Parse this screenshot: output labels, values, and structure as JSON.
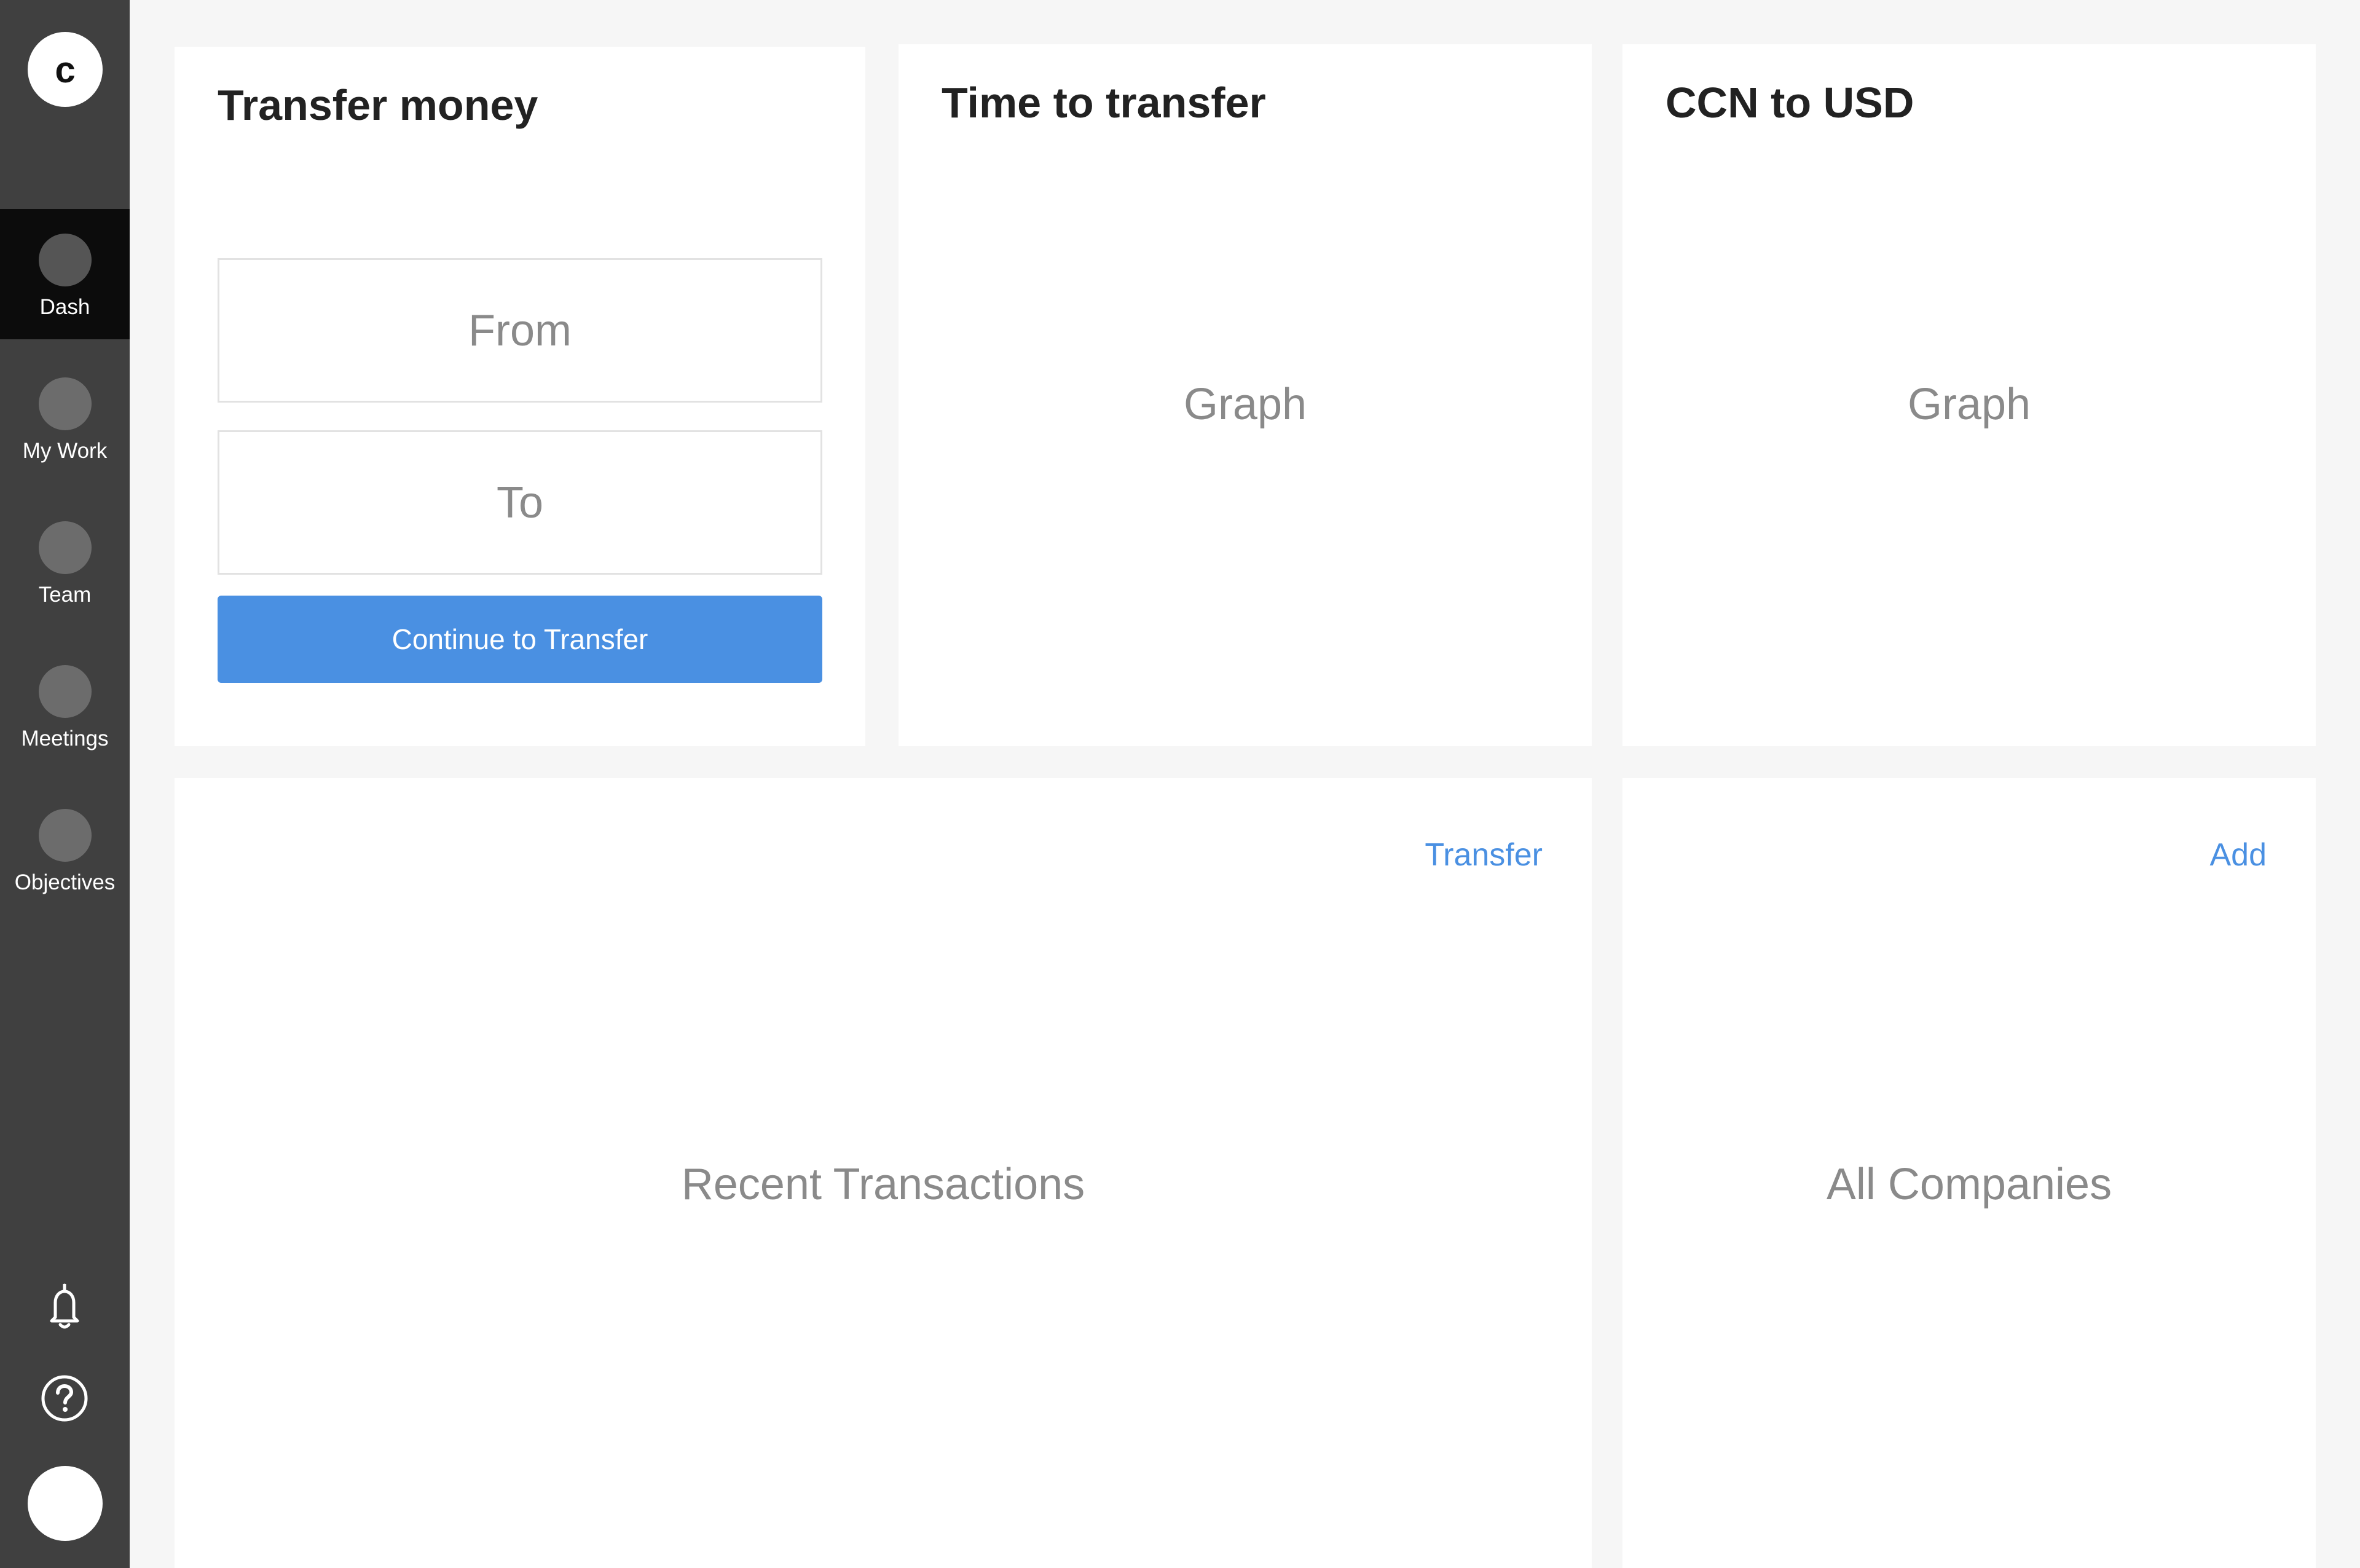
{
  "sidebar": {
    "logo_letter": "c",
    "items": [
      {
        "label": "Dash",
        "active": true
      },
      {
        "label": "My Work"
      },
      {
        "label": "Team"
      },
      {
        "label": "Meetings"
      },
      {
        "label": "Objectives"
      }
    ],
    "icons": {
      "notifications": "bell-icon",
      "help": "question-circle-icon",
      "profile": "avatar"
    }
  },
  "transfer_card": {
    "title": "Transfer money",
    "from_placeholder": "From",
    "to_placeholder": "To",
    "button_label": "Continue to Transfer"
  },
  "time_card": {
    "title": "Time to transfer",
    "placeholder": "Graph"
  },
  "rate_card": {
    "title": "CCN to USD",
    "placeholder": "Graph"
  },
  "transactions_card": {
    "action_label": "Transfer",
    "placeholder": "Recent Transactions"
  },
  "companies_card": {
    "action_label": "Add",
    "placeholder": "All Companies"
  },
  "colors": {
    "sidebar": "#404040",
    "sidebar_active": "#0c0c0c",
    "accent": "#4a90e2",
    "background": "#f6f6f6"
  }
}
